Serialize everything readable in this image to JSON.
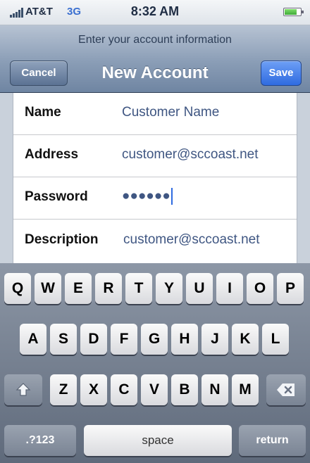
{
  "status": {
    "carrier": "AT&T",
    "network": "3G",
    "time": "8:32 AM"
  },
  "nav": {
    "prompt": "Enter your account information",
    "title": "New Account",
    "cancel": "Cancel",
    "save": "Save"
  },
  "form": {
    "fields": [
      {
        "label": "Name",
        "value": "Customer Name"
      },
      {
        "label": "Address",
        "value": "customer@sccoast.net"
      },
      {
        "label": "Password",
        "value": "●●●●●●"
      },
      {
        "label": "Description",
        "value": "customer@sccoast.net"
      }
    ]
  },
  "keyboard": {
    "row1": [
      "Q",
      "W",
      "E",
      "R",
      "T",
      "Y",
      "U",
      "I",
      "O",
      "P"
    ],
    "row2": [
      "A",
      "S",
      "D",
      "F",
      "G",
      "H",
      "J",
      "K",
      "L"
    ],
    "row3": [
      "Z",
      "X",
      "C",
      "V",
      "B",
      "N",
      "M"
    ],
    "shift_icon": "shift-arrow-icon",
    "delete_icon": "backspace-icon",
    "numbers": ".?123",
    "space": "space",
    "return": "return"
  }
}
